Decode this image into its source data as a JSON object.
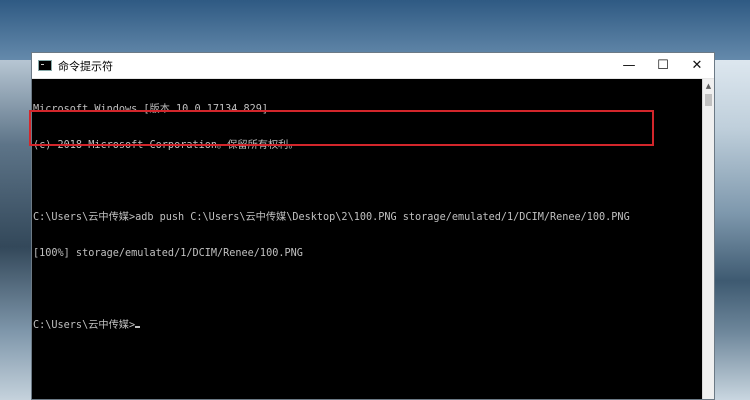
{
  "window": {
    "title": "命令提示符",
    "minimize_glyph": "—",
    "maximize_glyph": "☐",
    "close_glyph": "✕"
  },
  "console": {
    "lines": [
      "Microsoft Windows [版本 10.0.17134.829]",
      "(c) 2018 Microsoft Corporation。保留所有权利。",
      "",
      "C:\\Users\\云中传媒>adb push C:\\Users\\云中传媒\\Desktop\\2\\100.PNG storage/emulated/1/DCIM/Renee/100.PNG",
      "[100%] storage/emulated/1/DCIM/Renee/100.PNG",
      "",
      "C:\\Users\\云中传媒>"
    ]
  },
  "scrollbar": {
    "up_glyph": "▲"
  },
  "colors": {
    "highlight_border": "#d3262b",
    "console_text": "#c0c0c0",
    "console_bg": "#000000"
  }
}
